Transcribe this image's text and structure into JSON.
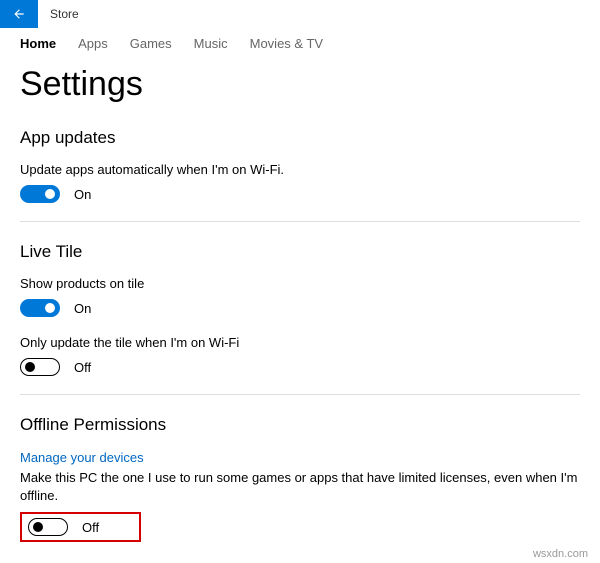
{
  "titlebar": {
    "app": "Store"
  },
  "tabs": [
    "Home",
    "Apps",
    "Games",
    "Music",
    "Movies & TV"
  ],
  "active_tab": 0,
  "page_title": "Settings",
  "sections": {
    "app_updates": {
      "title": "App updates",
      "setting1": {
        "label": "Update apps automatically when I'm on Wi-Fi.",
        "state": "On",
        "on": true
      }
    },
    "live_tile": {
      "title": "Live Tile",
      "setting1": {
        "label": "Show products on tile",
        "state": "On",
        "on": true
      },
      "setting2": {
        "label": "Only update the tile when I'm on Wi-Fi",
        "state": "Off",
        "on": false
      }
    },
    "offline": {
      "title": "Offline Permissions",
      "link": "Manage your devices",
      "desc": "Make this PC the one I use to run some games or apps that have limited licenses, even when I'm offline.",
      "setting1": {
        "state": "Off",
        "on": false
      }
    }
  },
  "watermark": "wsxdn.com"
}
